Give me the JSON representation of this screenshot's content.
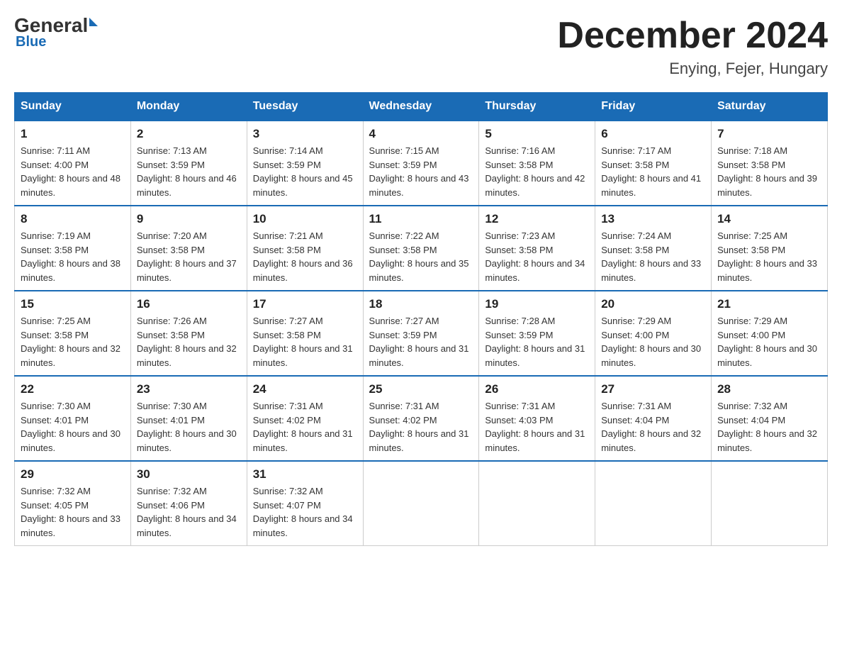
{
  "header": {
    "logo": {
      "general": "General",
      "blue": "Blue"
    },
    "title": "December 2024",
    "subtitle": "Enying, Fejer, Hungary"
  },
  "calendar": {
    "days_of_week": [
      "Sunday",
      "Monday",
      "Tuesday",
      "Wednesday",
      "Thursday",
      "Friday",
      "Saturday"
    ],
    "weeks": [
      [
        {
          "day": "1",
          "sunrise": "7:11 AM",
          "sunset": "4:00 PM",
          "daylight": "8 hours and 48 minutes."
        },
        {
          "day": "2",
          "sunrise": "7:13 AM",
          "sunset": "3:59 PM",
          "daylight": "8 hours and 46 minutes."
        },
        {
          "day": "3",
          "sunrise": "7:14 AM",
          "sunset": "3:59 PM",
          "daylight": "8 hours and 45 minutes."
        },
        {
          "day": "4",
          "sunrise": "7:15 AM",
          "sunset": "3:59 PM",
          "daylight": "8 hours and 43 minutes."
        },
        {
          "day": "5",
          "sunrise": "7:16 AM",
          "sunset": "3:58 PM",
          "daylight": "8 hours and 42 minutes."
        },
        {
          "day": "6",
          "sunrise": "7:17 AM",
          "sunset": "3:58 PM",
          "daylight": "8 hours and 41 minutes."
        },
        {
          "day": "7",
          "sunrise": "7:18 AM",
          "sunset": "3:58 PM",
          "daylight": "8 hours and 39 minutes."
        }
      ],
      [
        {
          "day": "8",
          "sunrise": "7:19 AM",
          "sunset": "3:58 PM",
          "daylight": "8 hours and 38 minutes."
        },
        {
          "day": "9",
          "sunrise": "7:20 AM",
          "sunset": "3:58 PM",
          "daylight": "8 hours and 37 minutes."
        },
        {
          "day": "10",
          "sunrise": "7:21 AM",
          "sunset": "3:58 PM",
          "daylight": "8 hours and 36 minutes."
        },
        {
          "day": "11",
          "sunrise": "7:22 AM",
          "sunset": "3:58 PM",
          "daylight": "8 hours and 35 minutes."
        },
        {
          "day": "12",
          "sunrise": "7:23 AM",
          "sunset": "3:58 PM",
          "daylight": "8 hours and 34 minutes."
        },
        {
          "day": "13",
          "sunrise": "7:24 AM",
          "sunset": "3:58 PM",
          "daylight": "8 hours and 33 minutes."
        },
        {
          "day": "14",
          "sunrise": "7:25 AM",
          "sunset": "3:58 PM",
          "daylight": "8 hours and 33 minutes."
        }
      ],
      [
        {
          "day": "15",
          "sunrise": "7:25 AM",
          "sunset": "3:58 PM",
          "daylight": "8 hours and 32 minutes."
        },
        {
          "day": "16",
          "sunrise": "7:26 AM",
          "sunset": "3:58 PM",
          "daylight": "8 hours and 32 minutes."
        },
        {
          "day": "17",
          "sunrise": "7:27 AM",
          "sunset": "3:58 PM",
          "daylight": "8 hours and 31 minutes."
        },
        {
          "day": "18",
          "sunrise": "7:27 AM",
          "sunset": "3:59 PM",
          "daylight": "8 hours and 31 minutes."
        },
        {
          "day": "19",
          "sunrise": "7:28 AM",
          "sunset": "3:59 PM",
          "daylight": "8 hours and 31 minutes."
        },
        {
          "day": "20",
          "sunrise": "7:29 AM",
          "sunset": "4:00 PM",
          "daylight": "8 hours and 30 minutes."
        },
        {
          "day": "21",
          "sunrise": "7:29 AM",
          "sunset": "4:00 PM",
          "daylight": "8 hours and 30 minutes."
        }
      ],
      [
        {
          "day": "22",
          "sunrise": "7:30 AM",
          "sunset": "4:01 PM",
          "daylight": "8 hours and 30 minutes."
        },
        {
          "day": "23",
          "sunrise": "7:30 AM",
          "sunset": "4:01 PM",
          "daylight": "8 hours and 30 minutes."
        },
        {
          "day": "24",
          "sunrise": "7:31 AM",
          "sunset": "4:02 PM",
          "daylight": "8 hours and 31 minutes."
        },
        {
          "day": "25",
          "sunrise": "7:31 AM",
          "sunset": "4:02 PM",
          "daylight": "8 hours and 31 minutes."
        },
        {
          "day": "26",
          "sunrise": "7:31 AM",
          "sunset": "4:03 PM",
          "daylight": "8 hours and 31 minutes."
        },
        {
          "day": "27",
          "sunrise": "7:31 AM",
          "sunset": "4:04 PM",
          "daylight": "8 hours and 32 minutes."
        },
        {
          "day": "28",
          "sunrise": "7:32 AM",
          "sunset": "4:04 PM",
          "daylight": "8 hours and 32 minutes."
        }
      ],
      [
        {
          "day": "29",
          "sunrise": "7:32 AM",
          "sunset": "4:05 PM",
          "daylight": "8 hours and 33 minutes."
        },
        {
          "day": "30",
          "sunrise": "7:32 AM",
          "sunset": "4:06 PM",
          "daylight": "8 hours and 34 minutes."
        },
        {
          "day": "31",
          "sunrise": "7:32 AM",
          "sunset": "4:07 PM",
          "daylight": "8 hours and 34 minutes."
        },
        null,
        null,
        null,
        null
      ]
    ]
  }
}
